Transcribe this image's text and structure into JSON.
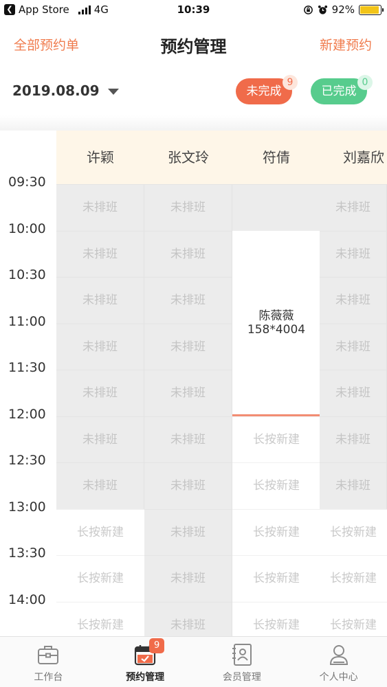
{
  "status_bar": {
    "back_app": "App Store",
    "network": "4G",
    "time": "10:39",
    "battery": "92%",
    "battery_level": 0.92
  },
  "nav": {
    "left": "全部预约单",
    "title": "预约管理",
    "right": "新建预约"
  },
  "filter": {
    "date": "2019.08.09",
    "pending_label": "未完成",
    "pending_count": "9",
    "done_label": "已完成",
    "done_count": "0"
  },
  "schedule": {
    "staff": [
      "许颖",
      "张文玲",
      "符倩",
      "刘嘉欣"
    ],
    "times": [
      "09:30",
      "10:00",
      "10:30",
      "11:00",
      "11:30",
      "12:00",
      "12:30",
      "13:00",
      "13:30",
      "14:00"
    ],
    "off_label": "未排班",
    "free_label": "长按新建",
    "grid": [
      [
        "off",
        "off",
        "off",
        "off",
        "off",
        "off",
        "off",
        "free",
        "free",
        "free"
      ],
      [
        "off",
        "off",
        "off",
        "off",
        "off",
        "off",
        "off",
        "off",
        "off",
        "off"
      ],
      [
        "blank",
        "booked",
        "booked",
        "booked",
        "booked",
        "free",
        "free",
        "free",
        "free",
        "free"
      ],
      [
        "off",
        "off",
        "off",
        "off",
        "off",
        "off",
        "off",
        "free",
        "free",
        "free"
      ]
    ],
    "booking": {
      "name": "陈薇薇",
      "phone": "158*4004"
    }
  },
  "tabs": [
    {
      "label": "工作台",
      "icon": "briefcase-icon"
    },
    {
      "label": "预约管理",
      "icon": "calendar-check-icon",
      "badge": "9"
    },
    {
      "label": "会员管理",
      "icon": "member-card-icon"
    },
    {
      "label": "个人中心",
      "icon": "user-icon"
    }
  ],
  "colors": {
    "accent": "#f07c4e",
    "pending": "#f06b4a",
    "done": "#57cc8d",
    "header_bg": "#fef6e8"
  }
}
